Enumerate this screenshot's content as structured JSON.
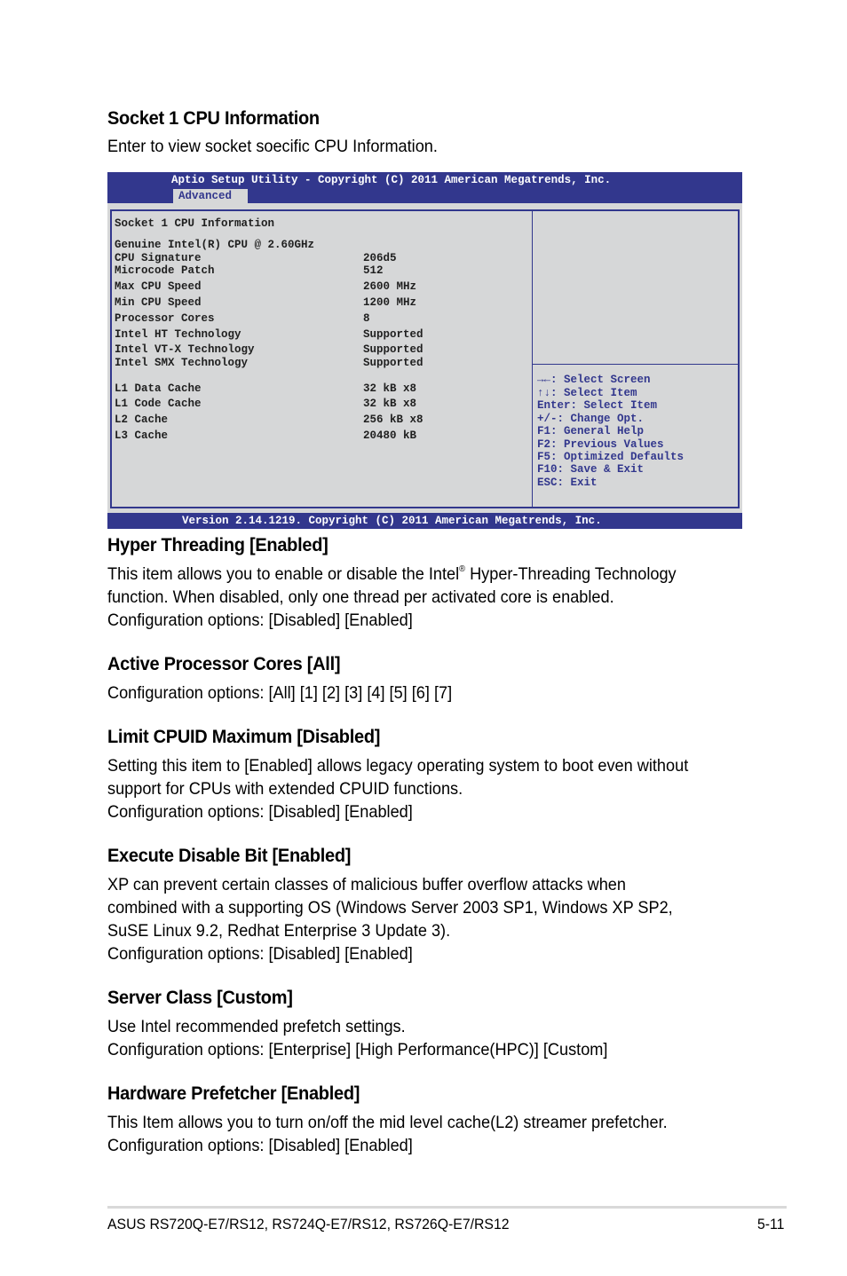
{
  "intro": {
    "heading": "Socket 1 CPU Information",
    "description": "Enter to view socket soecific CPU Information."
  },
  "bios": {
    "title": "Aptio Setup Utility - Copyright (C) 2011 American Megatrends, Inc.",
    "active_tab": "Advanced",
    "panel_title": "Socket 1 CPU Information",
    "cpu_name": "Genuine Intel(R) CPU @ 2.60GHz",
    "info_rows": [
      {
        "label": "CPU Signature",
        "value": "206d5"
      },
      {
        "label": "Microcode Patch",
        "value": "512"
      },
      {
        "label": "Max CPU Speed",
        "value": "2600 MHz"
      },
      {
        "label": "Min CPU Speed",
        "value": "1200 MHz"
      },
      {
        "label": "Processor Cores",
        "value": "8"
      },
      {
        "label": "Intel HT Technology",
        "value": "Supported"
      },
      {
        "label": "Intel VT-X Technology",
        "value": "Supported"
      },
      {
        "label": "Intel SMX Technology",
        "value": "Supported"
      }
    ],
    "cache_rows": [
      {
        "label": "L1 Data Cache",
        "value": "32 kB x8"
      },
      {
        "label": "L1 Code Cache",
        "value": "32 kB x8"
      },
      {
        "label": "L2 Cache",
        "value": "256 kB x8"
      },
      {
        "label": "L3 Cache",
        "value": "20480 kB"
      }
    ],
    "help_keys": [
      "→←: Select Screen",
      "↑↓:  Select Item",
      "Enter: Select Item",
      "+/-: Change Opt.",
      "F1: General Help",
      "F2: Previous Values",
      "F5: Optimized Defaults",
      "F10: Save & Exit",
      "ESC: Exit"
    ],
    "footer": "Version 2.14.1219. Copyright (C) 2011 American Megatrends, Inc.",
    "colors": {
      "bar": "#32378d",
      "panel": "#d6d7d8",
      "help_text": "#32378d"
    }
  },
  "sections": [
    {
      "heading": "Hyper Threading [Enabled]",
      "lines_before_sup": "This item allows you to enable or disable the Intel",
      "sup": "®",
      "lines_after_sup": " Hyper-Threading Technology",
      "lines": [
        "function. When disabled, only one thread per activated core is enabled.",
        "Configuration options: [Disabled] [Enabled]"
      ]
    },
    {
      "heading": "Active Processor Cores [All]",
      "lines": [
        "Configuration options: [All] [1] [2] [3] [4] [5] [6] [7]"
      ]
    },
    {
      "heading": "Limit CPUID Maximum [Disabled]",
      "lines": [
        "Setting this item to [Enabled] allows legacy operating system to boot even without",
        "support for CPUs with extended CPUID functions.",
        "Configuration options: [Disabled] [Enabled]"
      ]
    },
    {
      "heading": "Execute Disable Bit [Enabled]",
      "lines": [
        "XP can prevent certain classes of malicious buffer overflow attacks when",
        "combined with a supporting OS (Windows Server 2003 SP1, Windows XP SP2,",
        "SuSE Linux 9.2, Redhat Enterprise 3 Update 3).",
        "Configuration options: [Disabled] [Enabled]"
      ]
    },
    {
      "heading": "Server Class [Custom]",
      "lines": [
        "Use Intel recommended prefetch settings.",
        "Configuration options: [Enterprise] [High Performance(HPC)] [Custom]"
      ]
    },
    {
      "heading": "Hardware Prefetcher [Enabled]",
      "lines": [
        "This Item allows you to turn on/off the mid level cache(L2) streamer prefetcher.",
        "Configuration options: [Disabled] [Enabled]"
      ]
    }
  ],
  "page_footer": {
    "product": "ASUS RS720Q-E7/RS12, RS724Q-E7/RS12, RS726Q-E7/RS12",
    "page_number": "5-11"
  }
}
